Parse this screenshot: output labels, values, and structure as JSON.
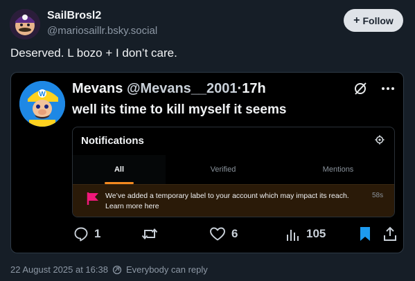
{
  "post": {
    "author_name": "SailBrosl2",
    "author_handle": "@mariosaillr.bsky.social",
    "follow_label": "Follow",
    "text": "Deserved. L bozo + I don’t care."
  },
  "quote": {
    "author_name": "Mevans",
    "author_handle": "@Mevans__2001",
    "separator": "·",
    "time": "17h",
    "text": "well its time to kill myself it seems",
    "notifications": {
      "title": "Notifications",
      "tabs": [
        {
          "label": "All",
          "active": true
        },
        {
          "label": "Verified",
          "active": false
        },
        {
          "label": "Mentions",
          "active": false
        }
      ],
      "alert": {
        "text": "We’ve added a temporary label to your account which may impact its reach. Learn more here",
        "time": "58s"
      }
    },
    "stats": {
      "replies": "1",
      "reposts": "",
      "likes": "6",
      "views": "105"
    }
  },
  "footer": {
    "date": "22 August 2025 at 16:38",
    "reply_setting": "Everybody can reply"
  },
  "colors": {
    "background": "#161e27",
    "accent_orange": "#f58a1f",
    "flag_pink": "#f0187a",
    "bookmark_blue": "#1d9bf0"
  }
}
